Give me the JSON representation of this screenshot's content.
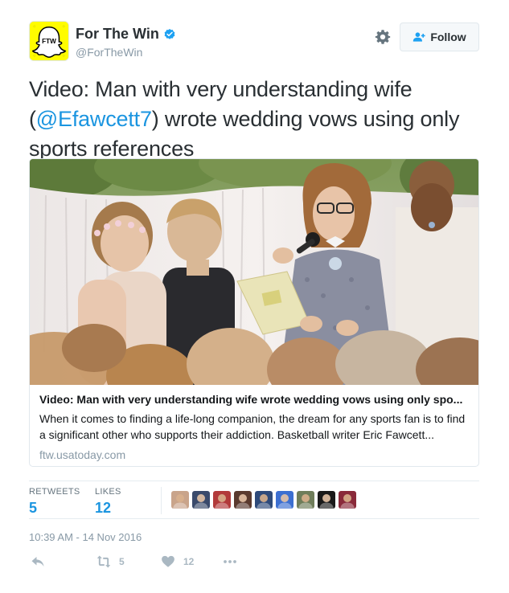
{
  "author": {
    "display_name": "For The Win",
    "handle": "@ForTheWin",
    "avatar_text": "FTW",
    "verified": true
  },
  "follow_button": {
    "label": "Follow"
  },
  "tweet": {
    "text_before": "Video: Man with very understanding wife (",
    "mention": "@Efawcett7",
    "text_after": ") wrote wedding vows using only sports references"
  },
  "card": {
    "title": "Video: Man with very understanding wife wrote wedding vows using only spo...",
    "description": "When it comes to finding a life-long companion, the dream for any sports fan is to find a significant other who supports their addiction. Basketball writer Eric Fawcett...",
    "domain": "ftw.usatoday.com"
  },
  "stats": {
    "retweets_label": "RETWEETS",
    "retweets_value": "5",
    "likes_label": "LIKES",
    "likes_value": "12"
  },
  "likers": [
    {
      "name": "liker-avatar",
      "bg": "#c9a48a"
    },
    {
      "name": "liker-avatar",
      "bg": "#3a4a6b"
    },
    {
      "name": "liker-avatar",
      "bg": "#b23a3a"
    },
    {
      "name": "liker-avatar",
      "bg": "#5a3a2e"
    },
    {
      "name": "liker-avatar",
      "bg": "#2e4a7a"
    },
    {
      "name": "liker-avatar",
      "bg": "#3c6fd1"
    },
    {
      "name": "liker-avatar",
      "bg": "#6f7d5a"
    },
    {
      "name": "liker-avatar",
      "bg": "#1a1a1a"
    },
    {
      "name": "liker-avatar",
      "bg": "#8a2a3a"
    }
  ],
  "timestamp": "10:39 AM - 14 Nov 2016",
  "actions": {
    "reply_icon": "reply-icon",
    "retweet_count": "5",
    "like_count": "12",
    "more_icon": "more-icon"
  },
  "colors": {
    "link": "#1b95e0",
    "muted": "#8899a6",
    "action_icon": "#aab8c2",
    "avatar_bg": "#fffc00"
  }
}
